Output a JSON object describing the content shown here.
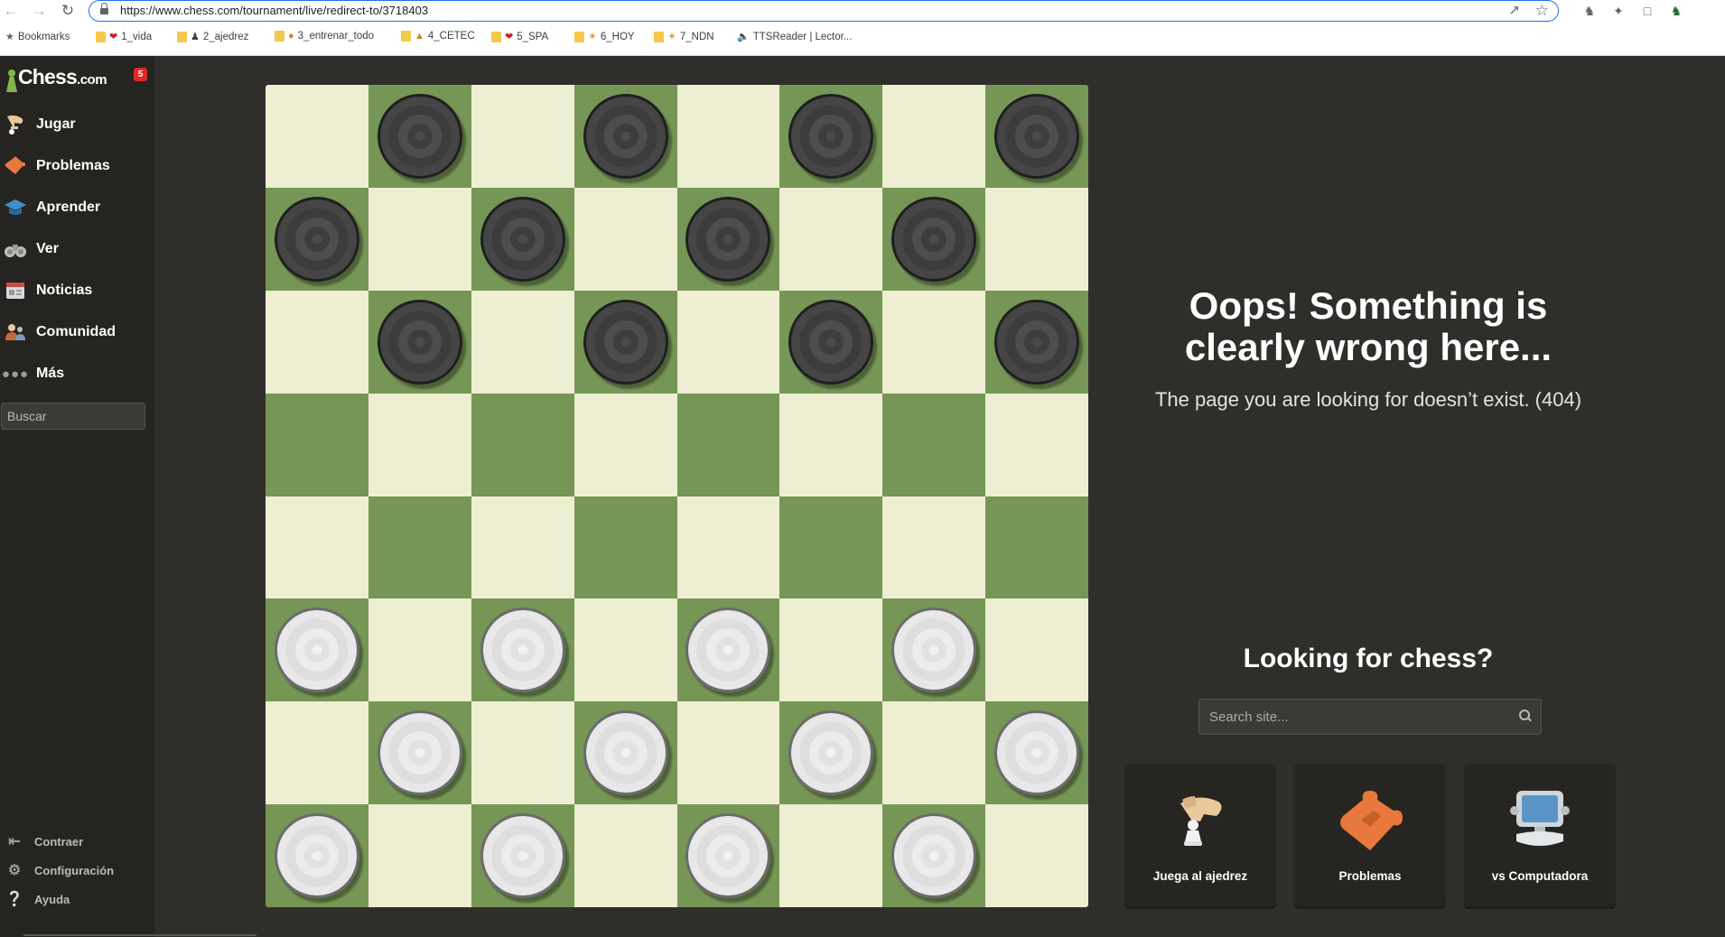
{
  "browser": {
    "url": "https://www.chess.com/tournament/live/redirect-to/3718403",
    "bookmarks": [
      {
        "label": "Bookmarks",
        "icon": "star-icon"
      },
      {
        "label": "1_vida",
        "icon": "heart-icon"
      },
      {
        "label": "2_ajedrez",
        "icon": "person-icon"
      },
      {
        "label": "3_entrenar_todo",
        "icon": "muscle-icon"
      },
      {
        "label": "4_CETEC",
        "icon": "pray-icon"
      },
      {
        "label": "5_SPA",
        "icon": "heart-icon"
      },
      {
        "label": "6_HOY",
        "icon": "sun-icon"
      },
      {
        "label": "7_NDN",
        "icon": "sun-icon"
      },
      {
        "label": "TTSReader | Lector...",
        "icon": "speaker-icon"
      }
    ]
  },
  "sidebar": {
    "logo_main": "Chess",
    "logo_suffix": ".com",
    "badge": "5",
    "nav": [
      {
        "label": "Jugar",
        "icon": "play-hand-icon"
      },
      {
        "label": "Problemas",
        "icon": "puzzle-icon"
      },
      {
        "label": "Aprender",
        "icon": "graduation-cap-icon"
      },
      {
        "label": "Ver",
        "icon": "binoculars-icon"
      },
      {
        "label": "Noticias",
        "icon": "newspaper-icon"
      },
      {
        "label": "Comunidad",
        "icon": "community-icon"
      },
      {
        "label": "Más",
        "icon": "more-dots-icon"
      }
    ],
    "search_placeholder": "Buscar",
    "bottom": [
      {
        "label": "Contraer",
        "icon": "collapse-icon"
      },
      {
        "label": "Configuración",
        "icon": "gear-icon"
      },
      {
        "label": "Ayuda",
        "icon": "help-icon"
      }
    ]
  },
  "board": {
    "rows": [
      "_b_b_b_b",
      "b_b_b_b_",
      "_b_b_b_b",
      "________",
      "________",
      "w_w_w_w_",
      "_w_w_w_w",
      "w_w_w_w_"
    ],
    "colors": {
      "light": "#eeeed2",
      "dark": "#769656"
    }
  },
  "error": {
    "title_line1": "Oops! Something is",
    "title_line2": "clearly wrong here...",
    "subtitle": "The page you are looking for doesn’t exist. (404)"
  },
  "looking": {
    "title": "Looking for chess?",
    "search_placeholder": "Search site...",
    "cards": [
      {
        "label": "Juega al ajedrez",
        "icon": "play-chess-icon"
      },
      {
        "label": "Problemas",
        "icon": "puzzle-icon"
      },
      {
        "label": "vs Computadora",
        "icon": "computer-icon"
      }
    ]
  }
}
